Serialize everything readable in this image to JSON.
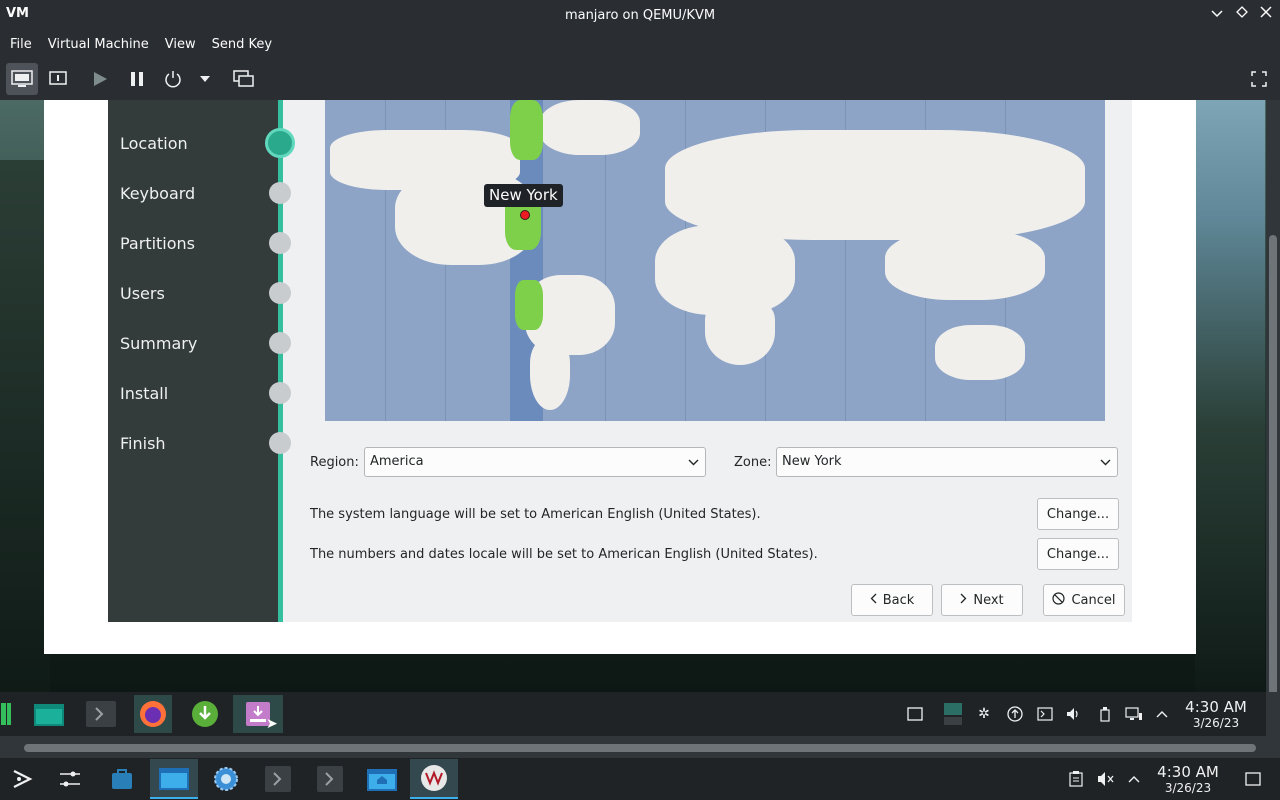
{
  "window": {
    "title": "manjaro on QEMU/KVM",
    "logo": "VM"
  },
  "menubar": {
    "items": [
      "File",
      "Virtual Machine",
      "View",
      "Send Key"
    ]
  },
  "toolbar": {
    "icons": [
      "console-icon",
      "details-icon",
      "run-icon",
      "pause-icon",
      "power-icon",
      "power-menu-dropdown-icon",
      "snapshots-icon",
      "fullscreen-icon"
    ]
  },
  "installer": {
    "steps": [
      "Location",
      "Keyboard",
      "Partitions",
      "Users",
      "Summary",
      "Install",
      "Finish"
    ],
    "current_step": "Location",
    "map": {
      "tooltip": "New York"
    },
    "region": {
      "label": "Region:",
      "value": "America"
    },
    "zone": {
      "label": "Zone:",
      "value": "New York"
    },
    "language_text": "The system language will be set to American English (United States).",
    "locale_text": "The numbers and dates locale will be set to American English (United States).",
    "change_label": "Change...",
    "back_label": "Back",
    "next_label": "Next",
    "cancel_label": "Cancel"
  },
  "guest_taskbar": {
    "clock": {
      "time": "4:30 AM",
      "date": "3/26/23"
    }
  },
  "host_taskbar": {
    "clock": {
      "time": "4:30 AM",
      "date": "3/26/23"
    }
  },
  "colors": {
    "accent": "#35bf9f",
    "sidebar": "#333b3b",
    "map_water": "#8ea4c6",
    "timezone_highlight": "#7ed04b",
    "pin": "#ed1c24"
  }
}
